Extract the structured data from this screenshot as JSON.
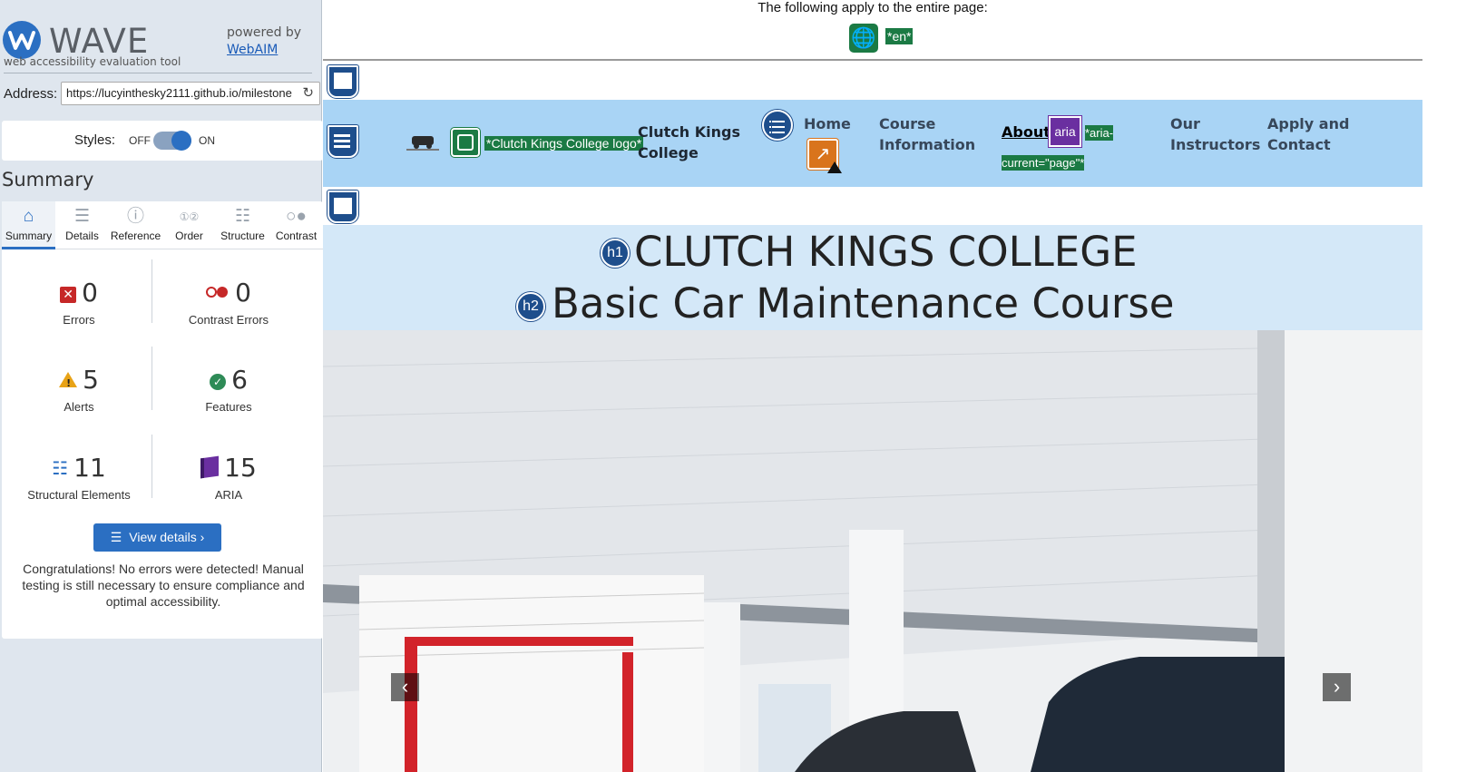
{
  "sidebar": {
    "logo_text": "WAVE",
    "tagline": "web accessibility evaluation tool",
    "powered_by": "powered by",
    "webaim_link": "WebAIM",
    "address_label": "Address:",
    "address_value": "https://lucyinthesky2111.github.io/milestone",
    "styles_label": "Styles:",
    "styles_off": "OFF",
    "styles_on": "ON",
    "styles_state": "on",
    "summary_heading": "Summary",
    "tabs": [
      {
        "label": "Summary",
        "icon": "home-icon"
      },
      {
        "label": "Details",
        "icon": "list-icon"
      },
      {
        "label": "Reference",
        "icon": "info-icon"
      },
      {
        "label": "Order",
        "icon": "order-icon"
      },
      {
        "label": "Structure",
        "icon": "structure-icon"
      },
      {
        "label": "Contrast",
        "icon": "contrast-icon"
      }
    ],
    "stats": {
      "errors": {
        "count": "0",
        "label": "Errors"
      },
      "contrast_errors": {
        "count": "0",
        "label": "Contrast Errors"
      },
      "alerts": {
        "count": "5",
        "label": "Alerts"
      },
      "features": {
        "count": "6",
        "label": "Features"
      },
      "structural": {
        "count": "11",
        "label": "Structural Elements"
      },
      "aria": {
        "count": "15",
        "label": "ARIA"
      }
    },
    "view_details": "View details ›",
    "congrats": "Congratulations! No errors were detected! Manual testing is still necessary to ensure compliance and optimal accessibility."
  },
  "page": {
    "notice": "The following apply to the entire page:",
    "lang_tag": "*en*",
    "logo_alt_tag": "*Clutch Kings College logo*",
    "brand_line1": "Clutch Kings",
    "brand_line2": "College",
    "nav": {
      "home": "Home",
      "course_1": "Course",
      "course_2": "Information",
      "about": "About",
      "aria_icon": "aria",
      "aria_tag_1": "*aria-",
      "aria_tag_2": "current=\"page\"*",
      "instructors_1": "Our",
      "instructors_2": "Instructors",
      "apply_1": "Apply and",
      "apply_2": "Contact"
    },
    "h1_badge": "h1",
    "h1": "CLUTCH KINGS COLLEGE",
    "h2_badge": "h2",
    "h2": "Basic Car Maintenance Course"
  },
  "colors": {
    "wave_blue": "#2b6fc2",
    "feature_green": "#1b7a44",
    "structure_navy": "#1e4e8c",
    "aria_purple": "#6a2fa0",
    "alert_orange": "#d9741c",
    "nav_bg": "#a9d4f5",
    "header_bg": "#d4e8f8"
  }
}
